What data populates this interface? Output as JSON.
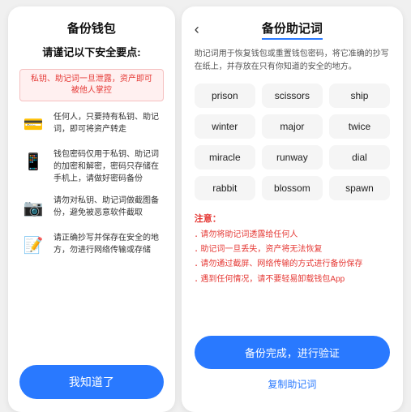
{
  "left": {
    "title": "备份钱包",
    "subtitle": "请谨记以下安全要点:",
    "warning": "私钥、助记词一旦泄露，资产即可被他人掌控",
    "items": [
      {
        "icon": "💳",
        "text": "任何人，只要持有私钥、助记词，即可将资产转走"
      },
      {
        "icon": "📱",
        "text": "钱包密码仅用于私钥、助记词的加密和解密，密码只存储在手机上，请做好密码备份"
      },
      {
        "icon": "📷",
        "text": "请勿对私钥、助记词做截图备份，避免被恶意软件截取"
      },
      {
        "icon": "📝",
        "text": "请正确抄写并保存在安全的地方，勿进行网络传输或存储"
      }
    ],
    "confirm_btn": "我知道了"
  },
  "right": {
    "back_icon": "‹",
    "title": "备份助记词",
    "desc": "助记词用于恢复钱包或重置钱包密码，将它准确的抄写在纸上，并存放在只有你知道的安全的地方。",
    "words": [
      "prison",
      "scissors",
      "ship",
      "winter",
      "major",
      "twice",
      "miracle",
      "runway",
      "dial",
      "rabbit",
      "blossom",
      "spawn"
    ],
    "notes_title": "注意：",
    "notes": [
      "请勿将助记词透露给任何人",
      "助记词一旦丢失，资产将无法恢复",
      "请勿通过截屏、网络传输的方式进行备份保存",
      "遇到任何情况，请不要轻易卸载钱包App"
    ],
    "confirm_btn": "备份完成，进行验证",
    "copy_btn": "复制助记词"
  }
}
